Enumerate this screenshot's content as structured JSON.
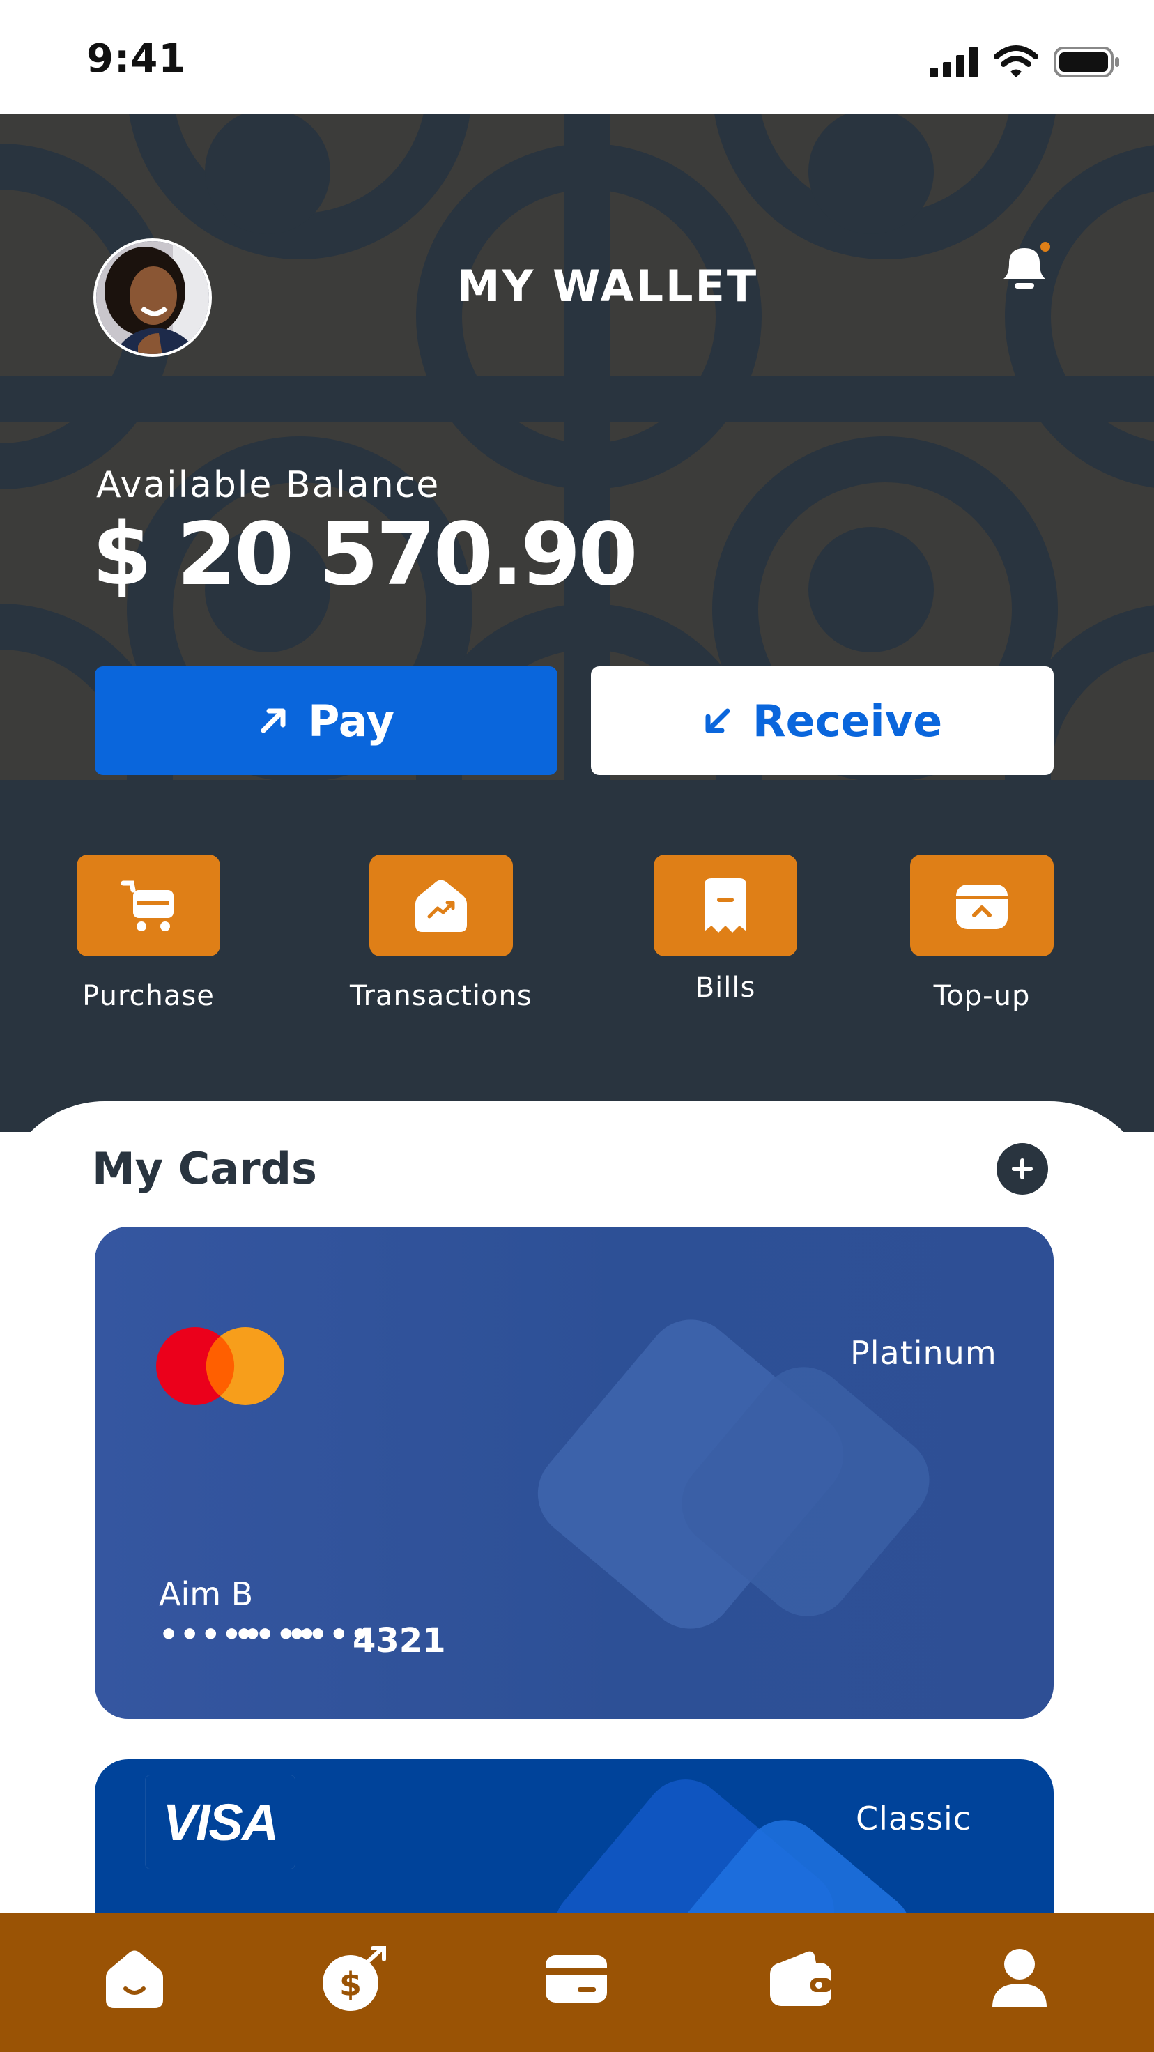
{
  "status_bar": {
    "time": "9:41"
  },
  "header": {
    "title": "MY WALLET"
  },
  "balance": {
    "label": "Available Balance",
    "value": "$ 20 570.90"
  },
  "buttons": {
    "pay": "Pay",
    "receive": "Receive"
  },
  "quick_actions": [
    {
      "label": "Purchase",
      "icon": "cart-icon"
    },
    {
      "label": "Transactions",
      "icon": "chart-icon"
    },
    {
      "label": "Bills",
      "icon": "receipt-icon"
    },
    {
      "label": "Top-up",
      "icon": "wallet-topup-icon"
    }
  ],
  "cards_section": {
    "title": "My Cards"
  },
  "cards": [
    {
      "brand": "mastercard",
      "tier": "Platinum",
      "holder": "Aim B",
      "masked_groups": [
        "•••••",
        "••••",
        "••••"
      ],
      "last4": "4321"
    },
    {
      "brand": "VISA",
      "tier": "Classic"
    }
  ],
  "bottom_nav": [
    {
      "icon": "home-icon"
    },
    {
      "icon": "money-transfer-icon"
    },
    {
      "icon": "card-icon"
    },
    {
      "icon": "wallet-icon"
    },
    {
      "icon": "profile-icon"
    }
  ],
  "colors": {
    "dark_bg": "#29343f",
    "accent_blue": "#0a66dc",
    "accent_orange": "#df7f17",
    "nav_brown": "#9a5305",
    "card_blue": "#2e4f95",
    "card_navy": "#00439a"
  }
}
